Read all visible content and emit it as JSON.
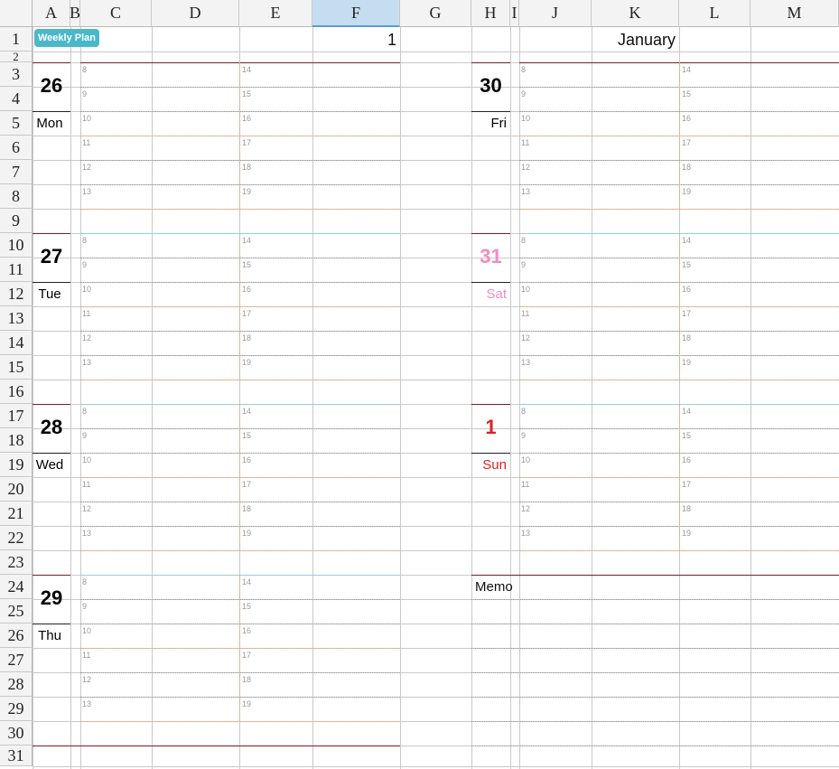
{
  "sheet": {
    "columns": [
      "A",
      "B",
      "C",
      "D",
      "E",
      "F",
      "G",
      "H",
      "I",
      "J",
      "K",
      "L",
      "M"
    ],
    "selected_column": "F",
    "rows": [
      "1",
      "2",
      "3",
      "4",
      "5",
      "6",
      "7",
      "8",
      "9",
      "10",
      "11",
      "12",
      "13",
      "14",
      "15",
      "16",
      "17",
      "18",
      "19",
      "20",
      "21",
      "22",
      "23",
      "24",
      "25",
      "26",
      "27",
      "28",
      "29",
      "30",
      "31"
    ]
  },
  "header": {
    "badge": "Weekly Plan",
    "week_value": "1",
    "month": "January"
  },
  "hours_left": [
    "8",
    "9",
    "10",
    "11",
    "12",
    "13"
  ],
  "hours_right": [
    "14",
    "15",
    "16",
    "17",
    "18",
    "19"
  ],
  "days_left": [
    {
      "num": "26",
      "name": "Mon"
    },
    {
      "num": "27",
      "name": "Tue"
    },
    {
      "num": "28",
      "name": "Wed"
    },
    {
      "num": "29",
      "name": "Thu"
    }
  ],
  "days_right": [
    {
      "num": "30",
      "name": "Fri"
    },
    {
      "num": "31",
      "name": "Sat"
    },
    {
      "num": "1",
      "name": "Sun"
    }
  ],
  "memo_label": "Memo",
  "colors": {
    "sat": "#f28cc0",
    "sun": "#e02020",
    "badge": "#4bb8c9"
  }
}
